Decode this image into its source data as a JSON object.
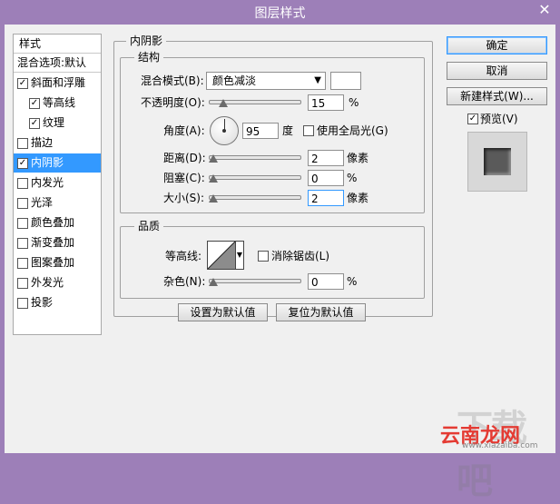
{
  "window": {
    "title": "图层样式",
    "close": "✕"
  },
  "style_list": {
    "header": "样式",
    "blend_options": "混合选项:默认",
    "items": [
      {
        "label": "斜面和浮雕",
        "checked": true,
        "indent": false
      },
      {
        "label": "等高线",
        "checked": true,
        "indent": true
      },
      {
        "label": "纹理",
        "checked": true,
        "indent": true
      },
      {
        "label": "描边",
        "checked": false,
        "indent": false
      },
      {
        "label": "内阴影",
        "checked": true,
        "indent": false,
        "selected": true
      },
      {
        "label": "内发光",
        "checked": false,
        "indent": false
      },
      {
        "label": "光泽",
        "checked": false,
        "indent": false
      },
      {
        "label": "颜色叠加",
        "checked": false,
        "indent": false
      },
      {
        "label": "渐变叠加",
        "checked": false,
        "indent": false
      },
      {
        "label": "图案叠加",
        "checked": false,
        "indent": false
      },
      {
        "label": "外发光",
        "checked": false,
        "indent": false
      },
      {
        "label": "投影",
        "checked": false,
        "indent": false
      }
    ]
  },
  "inner_shadow": {
    "title": "内阴影",
    "structure": {
      "title": "结构",
      "blend_mode_label": "混合模式(B):",
      "blend_mode_value": "颜色减淡",
      "blend_color": "#ffffff",
      "opacity_label": "不透明度(O):",
      "opacity_value": "15",
      "opacity_unit": "%",
      "opacity_slider": 15,
      "angle_label": "角度(A):",
      "angle_value": "95",
      "angle_unit": "度",
      "global_light_label": "使用全局光(G)",
      "global_light_checked": false,
      "distance_label": "距离(D):",
      "distance_value": "2",
      "distance_unit": "像素",
      "choke_label": "阻塞(C):",
      "choke_value": "0",
      "choke_unit": "%",
      "size_label": "大小(S):",
      "size_value": "2",
      "size_unit": "像素"
    },
    "quality": {
      "title": "品质",
      "contour_label": "等高线:",
      "antialias_label": "消除锯齿(L)",
      "antialias_checked": false,
      "noise_label": "杂色(N):",
      "noise_value": "0",
      "noise_unit": "%"
    },
    "make_default": "设置为默认值",
    "reset_default": "复位为默认值"
  },
  "buttons": {
    "ok": "确定",
    "cancel": "取消",
    "new_style": "新建样式(W)...",
    "preview_label": "预览(V)",
    "preview_checked": true
  },
  "watermark": {
    "site_name": "云南龙网",
    "domain": "www.xiazaiba.com",
    "big_text": "下载吧"
  },
  "colors": {
    "selection": "#3399ff",
    "titlebar": "#9d7fb8"
  }
}
